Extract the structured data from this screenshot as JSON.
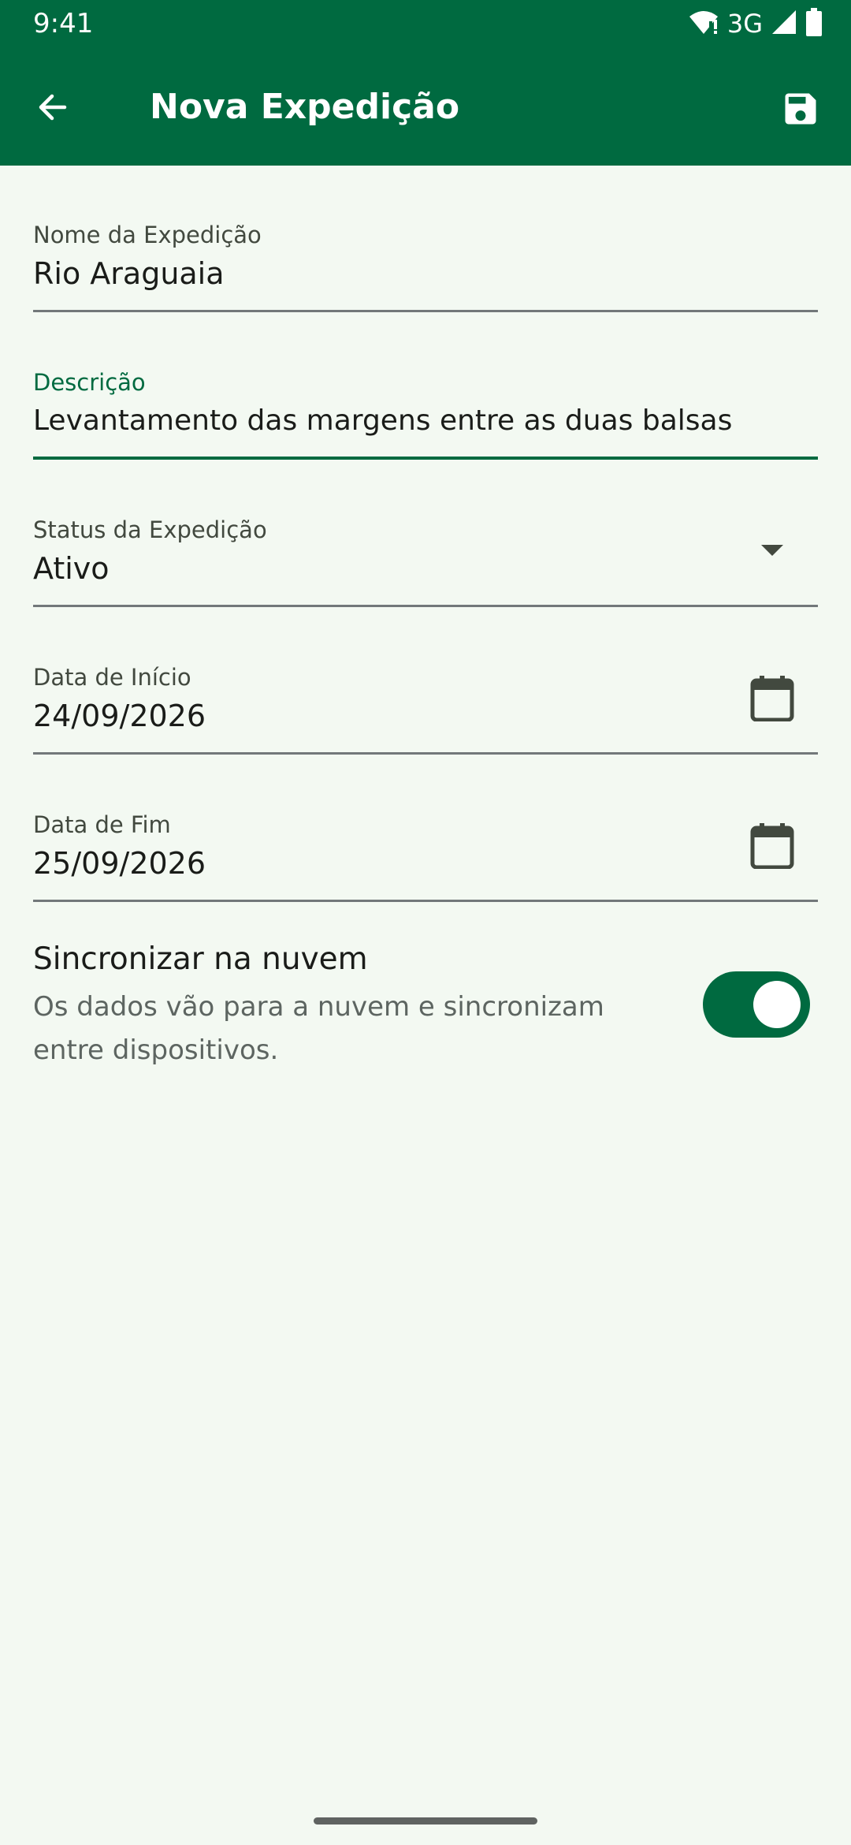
{
  "status_bar": {
    "time": "9:41",
    "network": "3G"
  },
  "app_bar": {
    "title": "Nova Expedição",
    "back_icon": "arrow-back-icon",
    "save_icon": "save-icon"
  },
  "form": {
    "name": {
      "label": "Nome da Expedição",
      "value": "Rio Araguaia"
    },
    "description": {
      "label": "Descrição",
      "value": "Levantamento das margens entre as duas balsas"
    },
    "status": {
      "label": "Status da Expedição",
      "value": "Ativo"
    },
    "start_date": {
      "label": "Data de Início",
      "value": "24/09/2026"
    },
    "end_date": {
      "label": "Data de Fim",
      "value": "25/09/2026"
    }
  },
  "sync": {
    "title": "Sincronizar na nuvem",
    "description": "Os dados vão para a nuvem e sincronizam entre dispositivos.",
    "enabled": true
  },
  "colors": {
    "primary": "#006A40",
    "background": "#F3F9F2",
    "text": "#1A1C19",
    "muted_text": "#5D6561"
  }
}
